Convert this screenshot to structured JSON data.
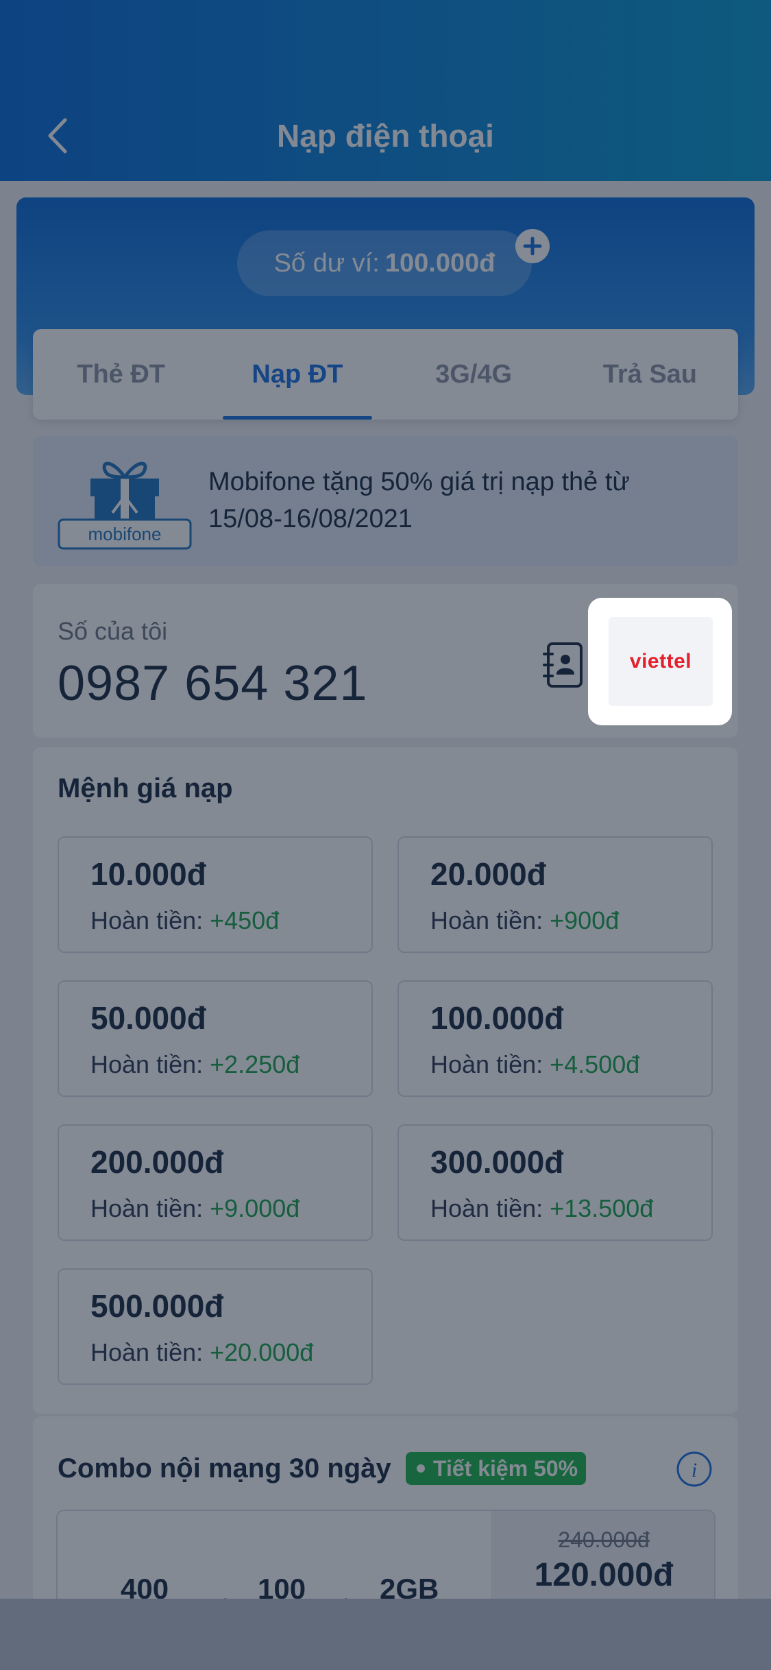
{
  "header": {
    "title": "Nạp  điện thoại",
    "back_icon": "chevron-left-icon"
  },
  "wallet": {
    "label": "Số dư ví:",
    "amount": "100.000đ",
    "add_icon": "plus-icon"
  },
  "tabs": [
    {
      "label": "Thẻ ĐT",
      "active": false
    },
    {
      "label": "Nạp ĐT",
      "active": true
    },
    {
      "label": "3G/4G",
      "active": false
    },
    {
      "label": "Trả Sau",
      "active": false
    }
  ],
  "promo": {
    "logo_text": "mobifone",
    "text": "Mobifone tặng 50% giá trị nạp thẻ từ 15/08-16/08/2021"
  },
  "phone": {
    "label": "Số của tôi",
    "number": "0987 654 321",
    "contacts_icon": "contacts-book-icon",
    "carrier": "viettel"
  },
  "denominations": {
    "title": "Mệnh giá nạp",
    "cashback_label": "Hoàn tiền:",
    "items": [
      {
        "value": "10.000đ",
        "cashback": "+450đ"
      },
      {
        "value": "20.000đ",
        "cashback": "+900đ"
      },
      {
        "value": "50.000đ",
        "cashback": "+2.250đ"
      },
      {
        "value": "100.000đ",
        "cashback": "+4.500đ"
      },
      {
        "value": "200.000đ",
        "cashback": "+9.000đ"
      },
      {
        "value": "300.000đ",
        "cashback": "+13.500đ"
      },
      {
        "value": "500.000đ",
        "cashback": "+20.000đ"
      }
    ]
  },
  "combo": {
    "title": "Combo nội mạng 30 ngày",
    "badge": "Tiết kiệm 50%",
    "info_icon": "info-icon",
    "items": [
      "400",
      "100",
      "2GB"
    ],
    "plus": "+",
    "old_price": "240.000đ",
    "new_price": "120.000đ"
  },
  "colors": {
    "primary": "#1a6fe0",
    "cashback_green": "#1aa34a",
    "badge_green": "#1db54a",
    "viettel_red": "#e3202d"
  }
}
